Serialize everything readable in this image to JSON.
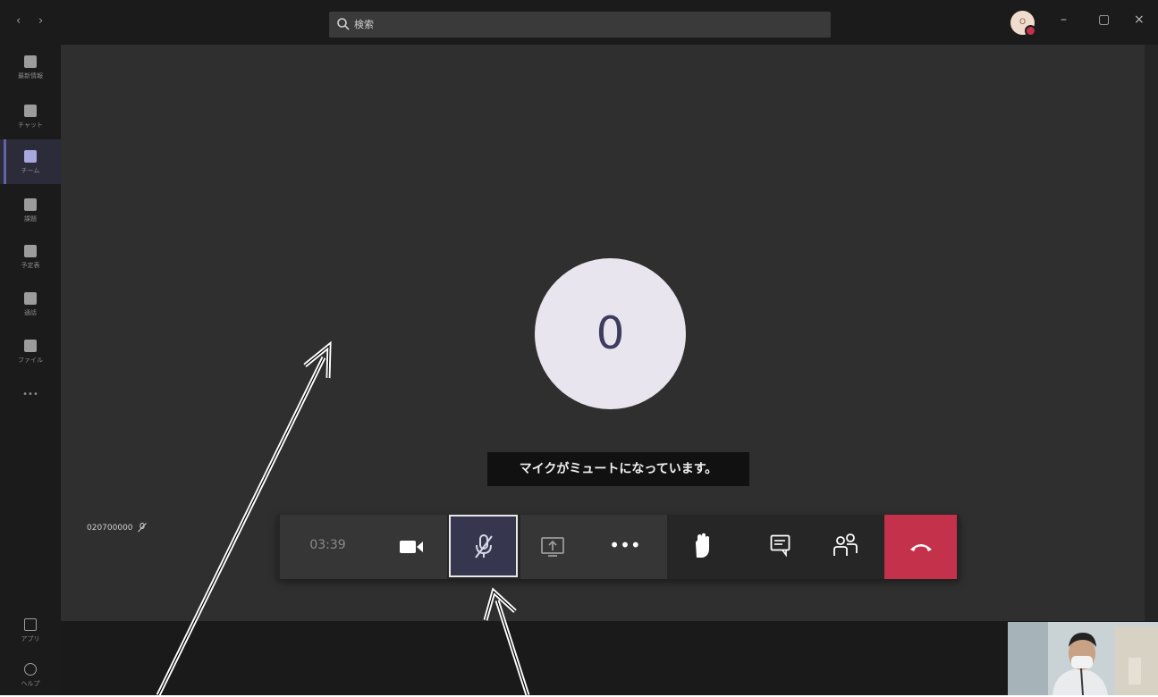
{
  "search": {
    "placeholder": "検索"
  },
  "user": {
    "initial": "O"
  },
  "rail": {
    "items": [
      {
        "label": "最新情報",
        "active": false
      },
      {
        "label": "チャット",
        "active": false
      },
      {
        "label": "チーム",
        "active": true
      },
      {
        "label": "課題",
        "active": false
      },
      {
        "label": "予定表",
        "active": false
      },
      {
        "label": "通話",
        "active": false
      },
      {
        "label": "ファイル",
        "active": false
      }
    ],
    "more_label": "•••",
    "apps_label": "アプリ",
    "help_label": "ヘルプ"
  },
  "call": {
    "participant_initial": "0",
    "muted_notice": "マイクがミュートになっています。",
    "caller_number": "020700000",
    "timer": "03:39",
    "more_label": "•••"
  },
  "colors": {
    "accent": "#6264a7",
    "hangup": "#c4314b",
    "stage": "#2f2f2f",
    "rail": "#1b1b1b"
  }
}
